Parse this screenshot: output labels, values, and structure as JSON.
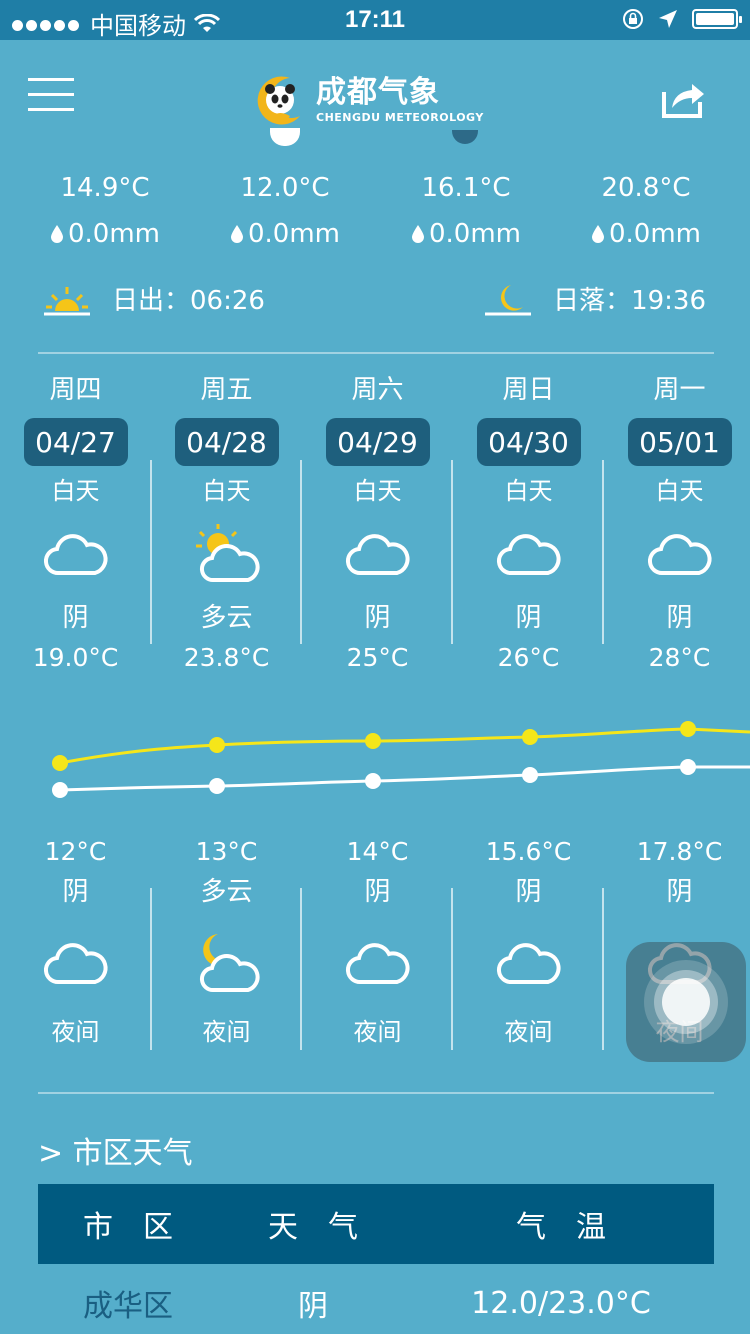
{
  "status_bar": {
    "carrier": "中国移动",
    "time": "17:11",
    "wifi_icon": "wifi-icon",
    "rotation_lock_icon": "rotation-lock-icon",
    "location_icon": "location-arrow-icon",
    "battery_icon": "battery-icon"
  },
  "header": {
    "menu_icon": "hamburger-menu-icon",
    "logo_title": "成都气象",
    "logo_subtitle": "CHENGDU METEOROLOGY",
    "share_icon": "share-icon"
  },
  "hourly": [
    {
      "temp": "14.9°C",
      "rain": "0.0mm"
    },
    {
      "temp": "12.0°C",
      "rain": "0.0mm"
    },
    {
      "temp": "16.1°C",
      "rain": "0.0mm"
    },
    {
      "temp": "20.8°C",
      "rain": "0.0mm"
    }
  ],
  "sun": {
    "sunrise_label": "日出：",
    "sunrise_time": "06:26",
    "sunset_label": "日落：",
    "sunset_time": "19:36"
  },
  "forecast": [
    {
      "weekday": "周四",
      "date": "04/27",
      "day_label": "白天",
      "day_desc": "阴",
      "day_icon": "cloud-icon",
      "high": "19.0°C",
      "low": "12°C",
      "night_desc": "阴",
      "night_icon": "cloud-icon",
      "night_label": "夜间"
    },
    {
      "weekday": "周五",
      "date": "04/28",
      "day_label": "白天",
      "day_desc": "多云",
      "day_icon": "partly-cloudy-day-icon",
      "high": "23.8°C",
      "low": "13°C",
      "night_desc": "多云",
      "night_icon": "partly-cloudy-night-icon",
      "night_label": "夜间"
    },
    {
      "weekday": "周六",
      "date": "04/29",
      "day_label": "白天",
      "day_desc": "阴",
      "day_icon": "cloud-icon",
      "high": "25°C",
      "low": "14°C",
      "night_desc": "阴",
      "night_icon": "cloud-icon",
      "night_label": "夜间"
    },
    {
      "weekday": "周日",
      "date": "04/30",
      "day_label": "白天",
      "day_desc": "阴",
      "day_icon": "cloud-icon",
      "high": "26°C",
      "low": "15.6°C",
      "night_desc": "阴",
      "night_icon": "cloud-icon",
      "night_label": "夜间"
    },
    {
      "weekday": "周一",
      "date": "05/01",
      "day_label": "白天",
      "day_desc": "阴",
      "day_icon": "cloud-icon",
      "high": "28°C",
      "low": "17.8°C",
      "night_desc": "阴",
      "night_icon": "cloud-icon",
      "night_label": "夜间"
    }
  ],
  "colors": {
    "background": "#55aecb",
    "status_bar": "#1f7ea6",
    "date_badge": "#1e5f7d",
    "high_line": "#f5e61a",
    "low_line": "#ffffff",
    "table_header": "#005a80",
    "district_text": "#1a5f82"
  },
  "city_weather": {
    "title": "> 市区天气",
    "headers": [
      "市　区",
      "天　气",
      "气　温"
    ],
    "rows": [
      {
        "district": "成华区",
        "weather": "阴",
        "temp": "12.0/23.0°C"
      }
    ]
  }
}
